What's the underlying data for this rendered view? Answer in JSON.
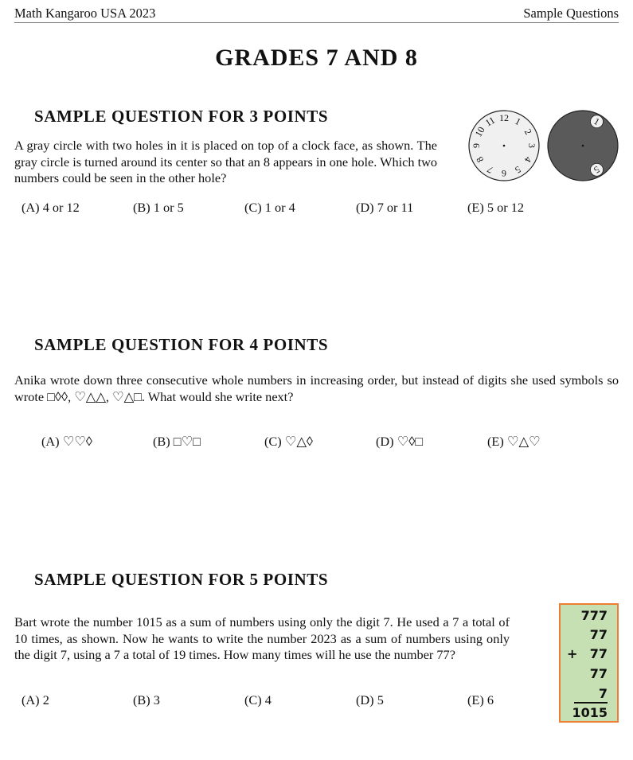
{
  "header": {
    "left": "Math Kangaroo USA 2023",
    "right": "Sample Questions"
  },
  "title": "GRADES 7 AND 8",
  "questions": [
    {
      "heading": "SAMPLE QUESTION FOR 3 POINTS",
      "text": "A gray circle with two holes in it is placed on top of a clock face, as shown. The gray circle is turned around its center so that an 8 appears in one hole. Which two numbers could be seen in the other hole?",
      "options": [
        {
          "label": "(A)",
          "value": "4 or 12"
        },
        {
          "label": "(B)",
          "value": "1 or 5"
        },
        {
          "label": "(C)",
          "value": "1 or 4"
        },
        {
          "label": "(D)",
          "value": "7 or 11"
        },
        {
          "label": "(E)",
          "value": "5 or 12"
        }
      ],
      "figure": {
        "clock_numbers": [
          "12",
          "1",
          "2",
          "3",
          "4",
          "5",
          "6",
          "7",
          "8",
          "9",
          "10",
          "11"
        ],
        "holes_show": [
          "1",
          "5"
        ],
        "clock_face_color": "#f0f0f0",
        "cover_color": "#5a5a5a"
      }
    },
    {
      "heading": "SAMPLE QUESTION FOR 4 POINTS",
      "text": "Anika wrote down three consecutive whole numbers in increasing order, but instead of digits she used symbols so wrote □◊◊, ♡△△, ♡△□. What would she write next?",
      "options": [
        {
          "label": "(A)",
          "value": "♡♡◊"
        },
        {
          "label": "(B)",
          "value": "□♡□"
        },
        {
          "label": "(C)",
          "value": "♡△◊"
        },
        {
          "label": "(D)",
          "value": "♡◊□"
        },
        {
          "label": "(E)",
          "value": "♡△♡"
        }
      ]
    },
    {
      "heading": "SAMPLE QUESTION FOR 5 POINTS",
      "text": "Bart wrote the number 1015 as a sum of numbers using only the digit 7. He used a 7 a total of 10 times, as shown. Now he wants to write the number 2023 as a sum of numbers using only the digit 7, using a 7 a total of 19 times. How many times will he use the number 77?",
      "options": [
        {
          "label": "(A)",
          "value": "2"
        },
        {
          "label": "(B)",
          "value": "3"
        },
        {
          "label": "(C)",
          "value": "4"
        },
        {
          "label": "(D)",
          "value": "5"
        },
        {
          "label": "(E)",
          "value": "6"
        }
      ],
      "figure": {
        "addends": [
          "777",
          "77",
          "77",
          "77",
          "7"
        ],
        "operator": "+",
        "total": "1015",
        "box_fill": "#c6e0b4",
        "box_border": "#ed7d31"
      }
    }
  ]
}
